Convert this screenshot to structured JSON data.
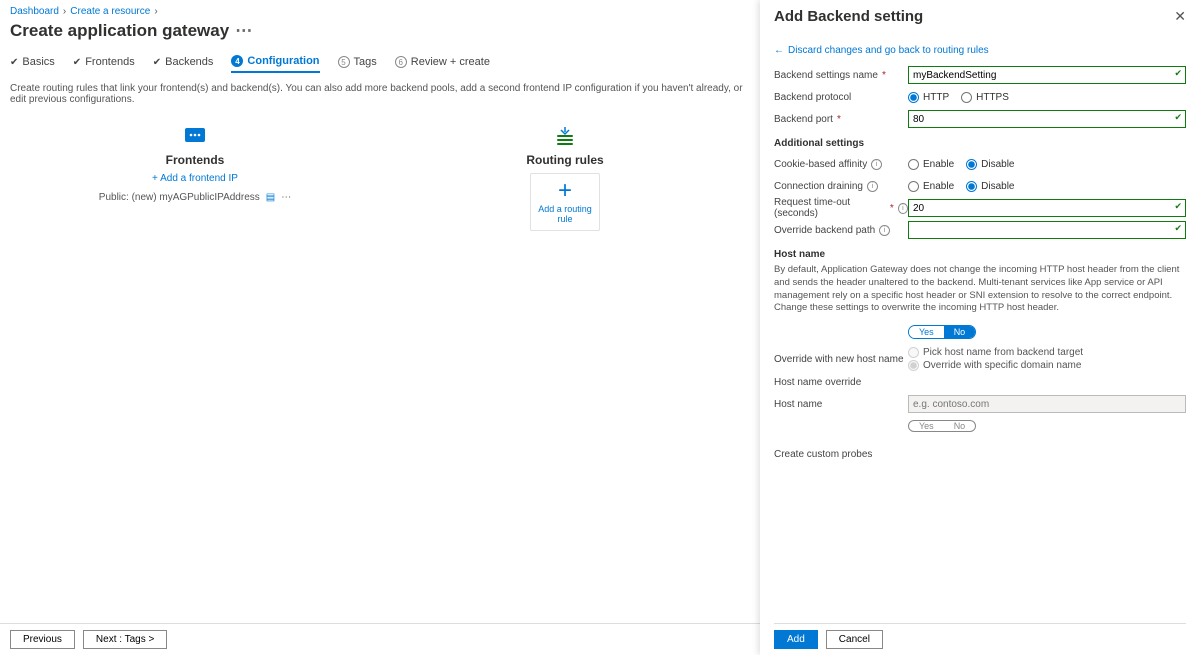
{
  "breadcrumb": {
    "items": [
      "Dashboard",
      "Create a resource"
    ]
  },
  "page_title": "Create application gateway",
  "tabs": {
    "t0": "Basics",
    "t1": "Frontends",
    "t2": "Backends",
    "t3": "Configuration",
    "t4": "Tags",
    "t5": "Review + create",
    "num4": "5",
    "num5": "6"
  },
  "instruction": "Create routing rules that link your frontend(s) and backend(s). You can also add more backend pools, add a second frontend IP configuration if you haven't already, or edit previous configurations.",
  "frontends": {
    "title": "Frontends",
    "add_link": "+ Add a frontend IP",
    "row_label": "Public: (new) myAGPublicIPAddress"
  },
  "rules": {
    "title": "Routing rules",
    "card_text": "Add a routing rule"
  },
  "footer": {
    "prev": "Previous",
    "next": "Next : Tags >"
  },
  "panel": {
    "title": "Add Backend setting",
    "discard": "Discard changes and go back to routing rules",
    "labels": {
      "name": "Backend settings name",
      "protocol": "Backend protocol",
      "port": "Backend port",
      "additional": "Additional settings",
      "affinity": "Cookie-based affinity",
      "draining": "Connection draining",
      "timeout": "Request time-out (seconds)",
      "override_path": "Override backend path",
      "hostname": "Host name",
      "override_new": "Override with new host name",
      "pick": "Pick host name from backend target",
      "specific": "Override with specific domain name",
      "host_override": "Host name override",
      "host": "Host name",
      "probes": "Create custom probes"
    },
    "values": {
      "name": "myBackendSetting",
      "port": "80",
      "timeout": "20",
      "override_path": "",
      "host_placeholder": "e.g. contoso.com"
    },
    "opts": {
      "http": "HTTP",
      "https": "HTTPS",
      "enable": "Enable",
      "disable": "Disable",
      "yes": "Yes",
      "no": "No"
    },
    "hostname_note": "By default, Application Gateway does not change the incoming HTTP host header from the client and sends the header unaltered to the backend. Multi-tenant services like App service or API management rely on a specific host header or SNI extension to resolve to the correct endpoint. Change these settings to overwrite the incoming HTTP host header.",
    "buttons": {
      "add": "Add",
      "cancel": "Cancel"
    }
  }
}
